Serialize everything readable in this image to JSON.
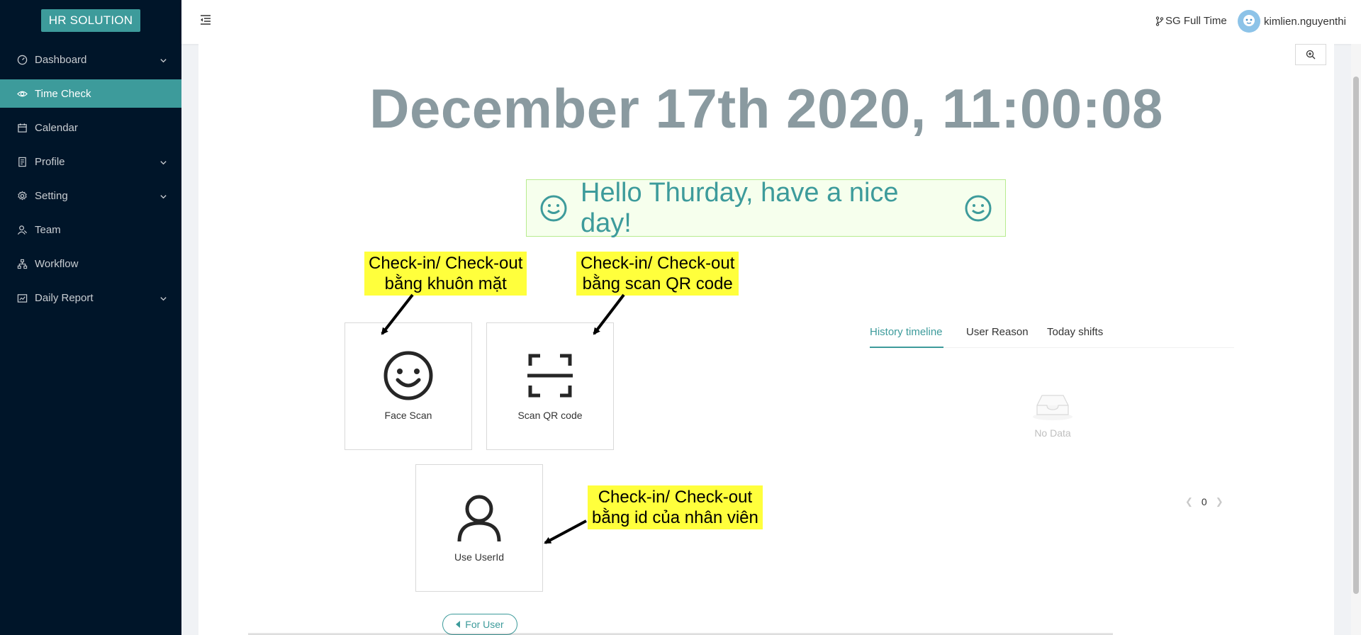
{
  "sidebar": {
    "logo": "HR SOLUTION",
    "items": [
      {
        "label": "Dashboard",
        "icon": "dashboard-icon"
      },
      {
        "label": "Time Check",
        "icon": "eye-icon"
      },
      {
        "label": "Calendar",
        "icon": "calendar-icon"
      },
      {
        "label": "Profile",
        "icon": "profile-icon"
      },
      {
        "label": "Setting",
        "icon": "gear-icon"
      },
      {
        "label": "Team",
        "icon": "team-icon"
      },
      {
        "label": "Workflow",
        "icon": "workflow-icon"
      },
      {
        "label": "Daily Report",
        "icon": "report-icon"
      }
    ]
  },
  "header": {
    "shift": "SG Full Time",
    "username": "kimlien.nguyenthi"
  },
  "main": {
    "clock": "December 17th 2020, 11:00:08",
    "greeting": "Hello Thurday, have a nice day!",
    "tiles": {
      "face": "Face Scan",
      "qr": "Scan QR code",
      "userid": "Use UserId"
    },
    "for_user": "For User"
  },
  "callouts": {
    "face": [
      "Check-in/ Check-out",
      "bằng khuôn mặt"
    ],
    "qr": [
      "Check-in/ Check-out",
      "bằng scan QR code"
    ],
    "userid": [
      "Check-in/ Check-out",
      "bằng id của nhân viên"
    ]
  },
  "history": {
    "tabs": [
      "History timeline",
      "User Reason",
      "Today shifts"
    ],
    "empty": "No Data",
    "page": "0"
  },
  "colors": {
    "sidebar_bg": "#001529",
    "accent": "#3d9b9b",
    "callout_bg": "#ffff3c"
  }
}
